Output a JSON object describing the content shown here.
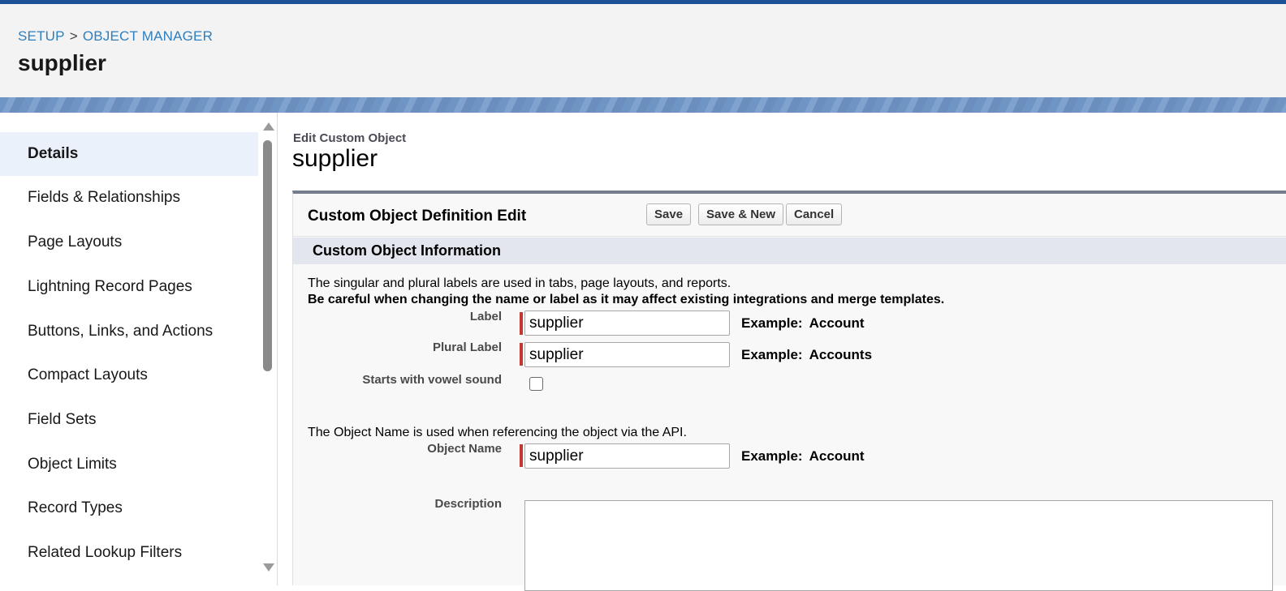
{
  "header": {
    "breadcrumb": [
      "SETUP",
      "OBJECT MANAGER"
    ],
    "breadcrumb_sep": ">",
    "title": "supplier"
  },
  "sidebar": {
    "items": [
      {
        "label": "Details",
        "active": true
      },
      {
        "label": "Fields & Relationships"
      },
      {
        "label": "Page Layouts"
      },
      {
        "label": "Lightning Record Pages"
      },
      {
        "label": "Buttons, Links, and Actions"
      },
      {
        "label": "Compact Layouts"
      },
      {
        "label": "Field Sets"
      },
      {
        "label": "Object Limits"
      },
      {
        "label": "Record Types"
      },
      {
        "label": "Related Lookup Filters"
      }
    ]
  },
  "main": {
    "eyebrow": "Edit Custom Object",
    "title": "supplier",
    "panel_title": "Custom Object Definition Edit",
    "buttons": {
      "save": "Save",
      "save_new": "Save & New",
      "cancel": "Cancel"
    },
    "section_title": "Custom Object Information",
    "note1": "The singular and plural labels are used in tabs, page layouts, and reports.",
    "note2": "Be careful when changing the name or label as it may affect existing integrations and merge templates.",
    "note3": "The Object Name is used when referencing the object via the API.",
    "fields": {
      "label": {
        "label": "Label",
        "value": "supplier",
        "example_key": "Example:",
        "example_value": "Account"
      },
      "plural_label": {
        "label": "Plural Label",
        "value": "supplier",
        "example_key": "Example:",
        "example_value": "Accounts"
      },
      "vowel": {
        "label": "Starts with vowel sound",
        "checked": false
      },
      "object_name": {
        "label": "Object Name",
        "value": "supplier",
        "example_key": "Example:",
        "example_value": "Account"
      },
      "description": {
        "label": "Description",
        "value": ""
      }
    }
  },
  "colors": {
    "accent": "#1b5297",
    "link": "#2e7fbf",
    "required": "#c23934",
    "active_bg": "#eaf1fb"
  }
}
